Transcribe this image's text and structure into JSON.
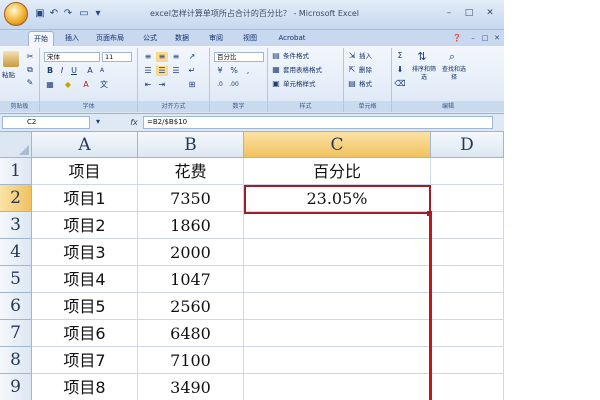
{
  "window": {
    "title": "excel怎样计算单项所占合计的百分比？ - Microsoft Excel",
    "accent_color": "#c5d7ee"
  },
  "ribbon_tabs": [
    "开始",
    "插入",
    "页面布局",
    "公式",
    "数据",
    "审阅",
    "视图",
    "Acrobat"
  ],
  "ribbon": {
    "clipboard": {
      "paste_label": "粘贴",
      "group_label": "剪贴板"
    },
    "font": {
      "font_name": "宋体",
      "font_size": "11",
      "group_label": "字体"
    },
    "alignment": {
      "group_label": "对齐方式"
    },
    "number": {
      "format": "百分比",
      "group_label": "数字"
    },
    "styles": {
      "conditional": "条件格式",
      "table_format": "套用表格格式",
      "cell_styles": "单元格样式",
      "group_label": "样式"
    },
    "cells": {
      "insert": "插入",
      "delete": "删除",
      "format": "格式",
      "group_label": "单元格"
    },
    "editing": {
      "sort_filter": "排序和筛选",
      "find_select": "查找和选择",
      "group_label": "编辑"
    }
  },
  "formula_bar": {
    "name_box": "C2",
    "fx": "fx",
    "formula": "=B2/$B$10"
  },
  "grid": {
    "columns": [
      "A",
      "B",
      "C",
      "D"
    ],
    "selected_column": "C",
    "rows": [
      {
        "num": "1",
        "a": "项目",
        "b": "花费",
        "c": "百分比"
      },
      {
        "num": "2",
        "a": "项目1",
        "b": "7350",
        "c": "23.05%"
      },
      {
        "num": "3",
        "a": "项目2",
        "b": "1860",
        "c": ""
      },
      {
        "num": "4",
        "a": "项目3",
        "b": "2000",
        "c": ""
      },
      {
        "num": "5",
        "a": "项目4",
        "b": "1047",
        "c": ""
      },
      {
        "num": "6",
        "a": "项目5",
        "b": "2560",
        "c": ""
      },
      {
        "num": "7",
        "a": "项目6",
        "b": "6480",
        "c": ""
      },
      {
        "num": "8",
        "a": "项目7",
        "b": "7100",
        "c": ""
      },
      {
        "num": "9",
        "a": "项目8",
        "b": "3490",
        "c": ""
      }
    ],
    "active_cell": "C2",
    "highlight_color": "#c4161c"
  }
}
